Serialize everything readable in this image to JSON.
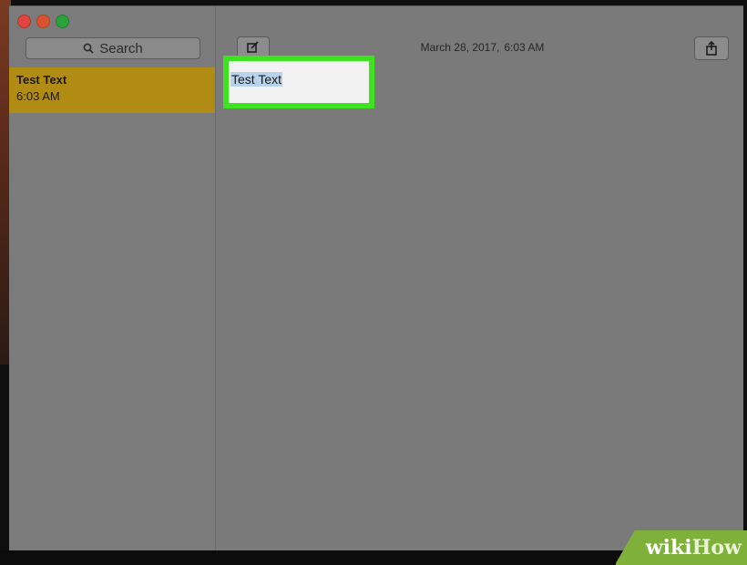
{
  "search": {
    "label": "Search",
    "icon": "search-icon"
  },
  "notes_list": [
    {
      "title": "Test Text",
      "time": "6:03 AM",
      "selected": true
    }
  ],
  "editor": {
    "date": "March 28, 2017,",
    "time": "6:03 AM",
    "body": "Test Text"
  },
  "toolbar": {
    "compose_icon": "compose-icon",
    "share_icon": "share-icon"
  },
  "watermark": {
    "part1": "wiki",
    "part2": "How"
  },
  "colors": {
    "selection": "#b08c14",
    "highlight": "#3ee31f",
    "text_selection": "#b9d3ea"
  }
}
